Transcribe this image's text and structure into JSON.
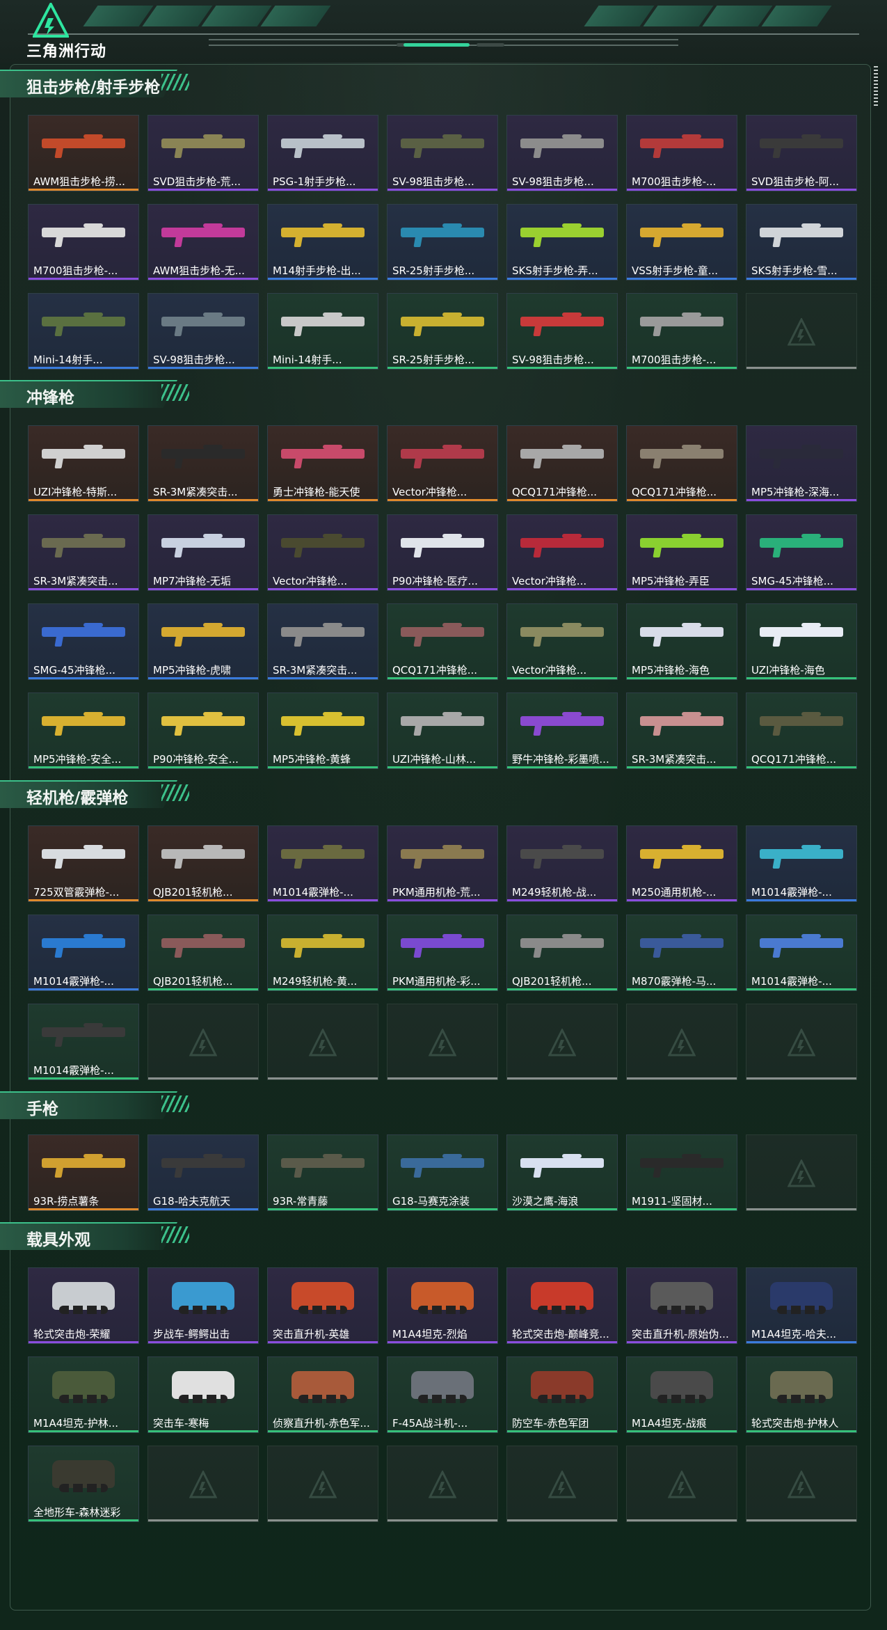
{
  "header": {
    "logo_text": "三角洲行动"
  },
  "sections": [
    {
      "title": "狙击步枪/射手步枪",
      "items": [
        {
          "label": "AWM狙击步枪-捞...",
          "rarity": "orange",
          "color": "#c24a2a"
        },
        {
          "label": "SVD狙击步枪-荒...",
          "rarity": "purple",
          "color": "#8a8455"
        },
        {
          "label": "PSG-1射手步枪...",
          "rarity": "purple",
          "color": "#b8c0c8"
        },
        {
          "label": "SV-98狙击步枪...",
          "rarity": "purple",
          "color": "#5a6044"
        },
        {
          "label": "SV-98狙击步枪...",
          "rarity": "purple",
          "color": "#8c8c8c"
        },
        {
          "label": "M700狙击步枪-...",
          "rarity": "purple",
          "color": "#b33a3a"
        },
        {
          "label": "SVD狙击步枪-阿...",
          "rarity": "purple",
          "color": "#3a3a3a"
        },
        {
          "label": "M700狙击步枪-...",
          "rarity": "purple",
          "color": "#d8d8d8"
        },
        {
          "label": "AWM狙击步枪-无...",
          "rarity": "purple",
          "color": "#c23a9a"
        },
        {
          "label": "M14射手步枪-出...",
          "rarity": "blue",
          "color": "#d4b030"
        },
        {
          "label": "SR-25射手步枪...",
          "rarity": "blue",
          "color": "#2a8ab0"
        },
        {
          "label": "SKS射手步枪-弄...",
          "rarity": "blue",
          "color": "#9ad030"
        },
        {
          "label": "VSS射手步枪-童...",
          "rarity": "blue",
          "color": "#d6a830"
        },
        {
          "label": "SKS射手步枪-雪...",
          "rarity": "blue",
          "color": "#d0d4d8"
        },
        {
          "label": "Mini-14射手...",
          "rarity": "blue",
          "color": "#5a7040"
        },
        {
          "label": "SV-98狙击步枪...",
          "rarity": "blue",
          "color": "#6a7a84"
        },
        {
          "label": "Mini-14射手...",
          "rarity": "green",
          "color": "#c8c8c8"
        },
        {
          "label": "SR-25射手步枪...",
          "rarity": "green",
          "color": "#c8b030"
        },
        {
          "label": "SV-98狙击步枪...",
          "rarity": "green",
          "color": "#c83a3a"
        },
        {
          "label": "M700狙击步枪-...",
          "rarity": "green",
          "color": "#9a9a9a"
        },
        {
          "label": "",
          "rarity": "empty",
          "color": ""
        }
      ]
    },
    {
      "title": "冲锋枪",
      "items": [
        {
          "label": "UZI冲锋枪-特斯...",
          "rarity": "orange",
          "color": "#d0d0d0"
        },
        {
          "label": "SR-3M紧凑突击...",
          "rarity": "orange",
          "color": "#2a2a2a"
        },
        {
          "label": "勇士冲锋枪-能天使",
          "rarity": "orange",
          "color": "#c84a6a"
        },
        {
          "label": "Vector冲锋枪...",
          "rarity": "orange",
          "color": "#b03a4a"
        },
        {
          "label": "QCQ171冲锋枪...",
          "rarity": "orange",
          "color": "#a8a8a8"
        },
        {
          "label": "QCQ171冲锋枪...",
          "rarity": "orange",
          "color": "#8a8070"
        },
        {
          "label": "MP5冲锋枪-深海...",
          "rarity": "purple",
          "color": "#2a2a3a"
        },
        {
          "label": "SR-3M紧凑突击...",
          "rarity": "purple",
          "color": "#6a6a50"
        },
        {
          "label": "MP7冲锋枪-无垢",
          "rarity": "purple",
          "color": "#c8d0e0"
        },
        {
          "label": "Vector冲锋枪...",
          "rarity": "purple",
          "color": "#4a4a30"
        },
        {
          "label": "P90冲锋枪-医疗...",
          "rarity": "purple",
          "color": "#e0e4ea"
        },
        {
          "label": "Vector冲锋枪...",
          "rarity": "purple",
          "color": "#b82a3a"
        },
        {
          "label": "MP5冲锋枪-弄臣",
          "rarity": "purple",
          "color": "#8ad030"
        },
        {
          "label": "SMG-45冲锋枪...",
          "rarity": "purple",
          "color": "#2ab07a"
        },
        {
          "label": "SMG-45冲锋枪...",
          "rarity": "blue",
          "color": "#3a6ad0"
        },
        {
          "label": "MP5冲锋枪-虎啸",
          "rarity": "blue",
          "color": "#d4a830"
        },
        {
          "label": "SR-3M紧凑突击...",
          "rarity": "blue",
          "color": "#8a8a8a"
        },
        {
          "label": "QCQ171冲锋枪...",
          "rarity": "green",
          "color": "#8a5a5a"
        },
        {
          "label": "Vector冲锋枪...",
          "rarity": "green",
          "color": "#8a8a60"
        },
        {
          "label": "MP5冲锋枪-海色",
          "rarity": "green",
          "color": "#d8dce8"
        },
        {
          "label": "UZI冲锋枪-海色",
          "rarity": "green",
          "color": "#e8ecf4"
        },
        {
          "label": "MP5冲锋枪-安全...",
          "rarity": "green",
          "color": "#d8b030"
        },
        {
          "label": "P90冲锋枪-安全...",
          "rarity": "green",
          "color": "#e0c040"
        },
        {
          "label": "MP5冲锋枪-黄蜂",
          "rarity": "green",
          "color": "#d8c030"
        },
        {
          "label": "UZI冲锋枪-山林...",
          "rarity": "green",
          "color": "#a8a8a8"
        },
        {
          "label": "野牛冲锋枪-彩墨喷...",
          "rarity": "green",
          "color": "#8a4ad0"
        },
        {
          "label": "SR-3M紧凑突击...",
          "rarity": "green",
          "color": "#c89090"
        },
        {
          "label": "QCQ171冲锋枪...",
          "rarity": "green",
          "color": "#5a5a40"
        }
      ]
    },
    {
      "title": "轻机枪/霰弹枪",
      "items": [
        {
          "label": "725双管霰弹枪-...",
          "rarity": "orange",
          "color": "#d8dce0"
        },
        {
          "label": "QJB201轻机枪...",
          "rarity": "orange",
          "color": "#b8b8b8"
        },
        {
          "label": "M1014霰弹枪-...",
          "rarity": "purple",
          "color": "#6a6a40"
        },
        {
          "label": "PKM通用机枪-荒...",
          "rarity": "purple",
          "color": "#8a7a50"
        },
        {
          "label": "M249轻机枪-战...",
          "rarity": "purple",
          "color": "#4a4a4a"
        },
        {
          "label": "M250通用机枪-...",
          "rarity": "purple",
          "color": "#d8b030"
        },
        {
          "label": "M1014霰弹枪-...",
          "rarity": "blue",
          "color": "#3ab0c8"
        },
        {
          "label": "M1014霰弹枪-...",
          "rarity": "blue",
          "color": "#2a7ad0"
        },
        {
          "label": "QJB201轻机枪...",
          "rarity": "green",
          "color": "#8a5a5a"
        },
        {
          "label": "M249轻机枪-黄...",
          "rarity": "green",
          "color": "#c8b030"
        },
        {
          "label": "PKM通用机枪-彩...",
          "rarity": "green",
          "color": "#7a4ad0"
        },
        {
          "label": "QJB201轻机枪...",
          "rarity": "green",
          "color": "#8a8a8a"
        },
        {
          "label": "M870霰弹枪-马...",
          "rarity": "green",
          "color": "#3a5a9a"
        },
        {
          "label": "M1014霰弹枪-...",
          "rarity": "green",
          "color": "#4a7ad0"
        },
        {
          "label": "M1014霰弹枪-...",
          "rarity": "green",
          "color": "#3a3a3a"
        },
        {
          "label": "",
          "rarity": "empty",
          "color": ""
        },
        {
          "label": "",
          "rarity": "empty",
          "color": ""
        },
        {
          "label": "",
          "rarity": "empty",
          "color": ""
        },
        {
          "label": "",
          "rarity": "empty",
          "color": ""
        },
        {
          "label": "",
          "rarity": "empty",
          "color": ""
        },
        {
          "label": "",
          "rarity": "empty",
          "color": ""
        }
      ]
    },
    {
      "title": "手枪",
      "items": [
        {
          "label": "93R-捞点薯条",
          "rarity": "orange",
          "color": "#d0a030"
        },
        {
          "label": "G18-哈夫克航天",
          "rarity": "blue",
          "color": "#3a3a3a"
        },
        {
          "label": "93R-常青藤",
          "rarity": "green",
          "color": "#5a5a4a"
        },
        {
          "label": "G18-马赛克涂装",
          "rarity": "green",
          "color": "#3a6a9a"
        },
        {
          "label": "沙漠之鹰-海浪",
          "rarity": "green",
          "color": "#d8e0f0"
        },
        {
          "label": "M1911-坚固材...",
          "rarity": "green",
          "color": "#2a2a2a"
        },
        {
          "label": "",
          "rarity": "empty",
          "color": ""
        }
      ]
    },
    {
      "title": "载具外观",
      "items": [
        {
          "label": "轮式突击炮-荣耀",
          "rarity": "purple",
          "color": "#c8ccd0"
        },
        {
          "label": "步战车-鳄鳄出击",
          "rarity": "purple",
          "color": "#3a9ad0"
        },
        {
          "label": "突击直升机-英雄",
          "rarity": "purple",
          "color": "#c84a2a"
        },
        {
          "label": "M1A4坦克-烈焰",
          "rarity": "purple",
          "color": "#c85a2a"
        },
        {
          "label": "轮式突击炮-巅峰竞...",
          "rarity": "purple",
          "color": "#c83a2a"
        },
        {
          "label": "突击直升机-原始伪...",
          "rarity": "purple",
          "color": "#5a5a5a"
        },
        {
          "label": "M1A4坦克-哈夫...",
          "rarity": "blue",
          "color": "#2a3a6a"
        },
        {
          "label": "M1A4坦克-护林...",
          "rarity": "green",
          "color": "#4a5a3a"
        },
        {
          "label": "突击车-寒梅",
          "rarity": "green",
          "color": "#e0e0e0"
        },
        {
          "label": "侦察直升机-赤色军...",
          "rarity": "green",
          "color": "#a85a3a"
        },
        {
          "label": "F-45A战斗机-...",
          "rarity": "green",
          "color": "#6a7078"
        },
        {
          "label": "防空车-赤色军团",
          "rarity": "green",
          "color": "#8a3a2a"
        },
        {
          "label": "M1A4坦克-战痕",
          "rarity": "green",
          "color": "#4a4a4a"
        },
        {
          "label": "轮式突击炮-护林人",
          "rarity": "green",
          "color": "#6a6a50"
        },
        {
          "label": "全地形车-森林迷彩",
          "rarity": "green",
          "color": "#3a3a30"
        },
        {
          "label": "",
          "rarity": "empty",
          "color": ""
        },
        {
          "label": "",
          "rarity": "empty",
          "color": ""
        },
        {
          "label": "",
          "rarity": "empty",
          "color": ""
        },
        {
          "label": "",
          "rarity": "empty",
          "color": ""
        },
        {
          "label": "",
          "rarity": "empty",
          "color": ""
        },
        {
          "label": "",
          "rarity": "empty",
          "color": ""
        }
      ]
    }
  ]
}
